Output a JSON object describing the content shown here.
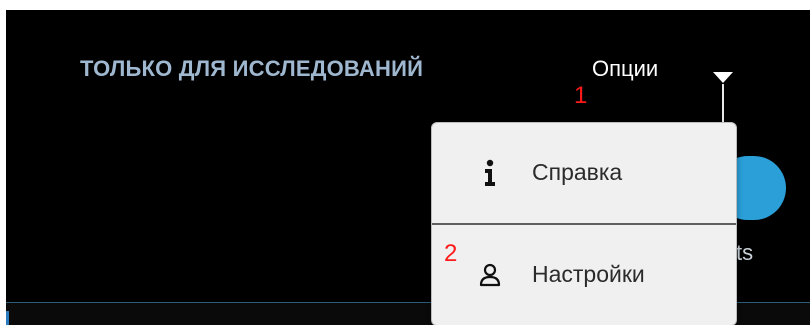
{
  "header": {
    "research_label": "ТОЛЬКО ДЛЯ ИССЛЕДОВАНИЙ",
    "options_label": "Опции"
  },
  "annotations": {
    "marker_1": "1",
    "marker_2": "2",
    "color": "#ff1a1a"
  },
  "background": {
    "partial_text": "ts",
    "toggle_color": "#2a9fd8"
  },
  "menu": {
    "items": [
      {
        "label": "Справка",
        "icon": "info-icon"
      },
      {
        "label": "Настройки",
        "icon": "user-icon"
      }
    ]
  }
}
